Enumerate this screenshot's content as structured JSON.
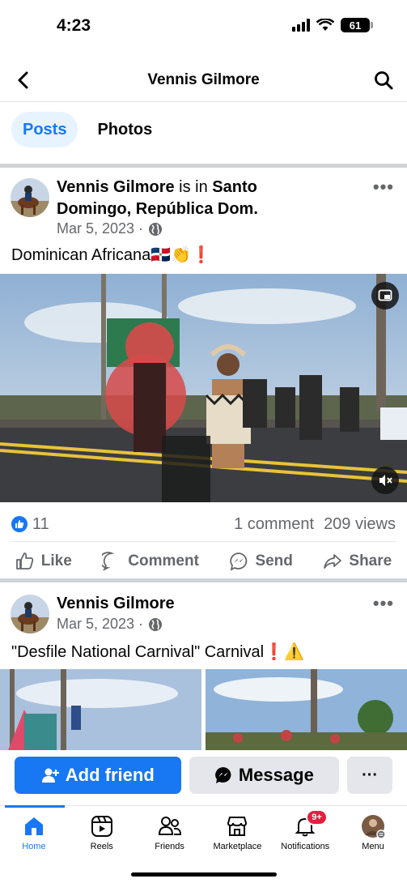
{
  "status_bar": {
    "time": "4:23",
    "battery": "61"
  },
  "header": {
    "title": "Vennis Gilmore"
  },
  "tabs": [
    {
      "label": "Posts",
      "active": true
    },
    {
      "label": "Photos",
      "active": false
    }
  ],
  "posts": [
    {
      "author": "Vennis Gilmore",
      "connector": " is in ",
      "location": "Santo Domingo, República Dom.",
      "date": "Mar 5, 2023 ·",
      "text": "Dominican Africana🇩🇴👏❗",
      "likes": "11",
      "comments": "1 comment",
      "views": "209 views"
    },
    {
      "author": "Vennis Gilmore",
      "date": "Mar 5, 2023 ·",
      "text": "\"Desfile National Carnival\" Carnival❗⚠️"
    }
  ],
  "actions": [
    {
      "label": "Like",
      "icon": "thumbs-up-icon"
    },
    {
      "label": "Comment",
      "icon": "comment-icon"
    },
    {
      "label": "Send",
      "icon": "messenger-icon"
    },
    {
      "label": "Share",
      "icon": "share-icon"
    }
  ],
  "profile_actions": {
    "add_friend": "Add friend",
    "message": "Message",
    "more": "···"
  },
  "bottom_nav": [
    {
      "label": "Home",
      "active": true
    },
    {
      "label": "Reels"
    },
    {
      "label": "Friends"
    },
    {
      "label": "Marketplace"
    },
    {
      "label": "Notifications",
      "badge": "9+"
    },
    {
      "label": "Menu"
    }
  ],
  "colors": {
    "accent": "#1877f2",
    "badge": "#e41e3f",
    "muted": "#65676b"
  }
}
